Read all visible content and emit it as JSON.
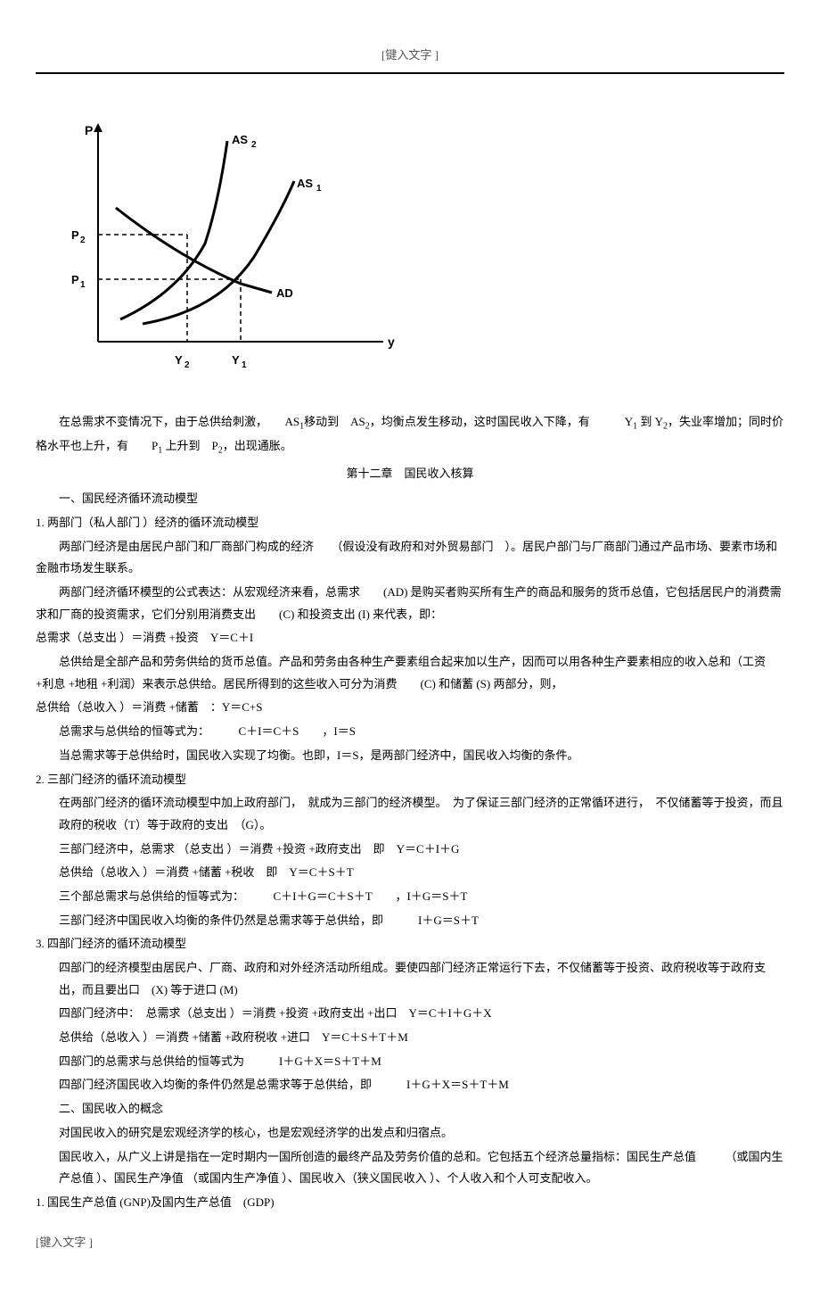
{
  "header": {
    "placeholder": "[键入文字 ]"
  },
  "footer": {
    "placeholder": "[键入文字 ]"
  },
  "chart_data": {
    "type": "line",
    "title": "",
    "xlabel": "y",
    "ylabel": "P",
    "curves": [
      {
        "name": "AS₂",
        "type": "upward"
      },
      {
        "name": "AS₁",
        "type": "upward"
      },
      {
        "name": "AD",
        "type": "downward"
      }
    ],
    "intersections": [
      {
        "label_x": "Y₂",
        "label_y": "P₂"
      },
      {
        "label_x": "Y₁",
        "label_y": "P₁"
      }
    ],
    "axis_labels": {
      "y_markers": [
        "P₂",
        "P₁"
      ],
      "x_markers": [
        "Y₂",
        "Y₁"
      ]
    }
  },
  "para1": {
    "part1": "在总需求不变情况下，由于总供给刺激，　　AS",
    "sub1": "1",
    "part2": "移动到　AS",
    "sub2": "2",
    "part3": "，均衡点发生移动，这时国民收入下降，有　　　Y",
    "sub3": "1",
    "part4": " 到 Y",
    "sub4": "2",
    "part5": "，失业率增加；同时价格水平也上升，有　　P",
    "sub5": "1",
    "part6": " 上升到　P",
    "sub6": "2",
    "part7": "，出现通胀。"
  },
  "chapter_title": "第十二章　国民收入核算",
  "section1_title": "一、国民经济循环流动模型",
  "item1_title": "1. 两部门（私人部门 ）经济的循环流动模型",
  "item1_p1": "两部门经济是由居民户部门和厂商部门构成的经济　　（假设没有政府和对外贸易部门　）。居民户部门与厂商部门通过产品市场、要素市场和金融市场发生联系。",
  "item1_p2": "两部门经济循环模型的公式表达：从宏观经济来看，总需求　　(AD) 是购买者购买所有生产的商品和服务的货币总值，它包括居民户的消费需求和厂商的投资需求，它们分别用消费支出　　(C) 和投资支出 (I) 来代表，即：",
  "item1_f1": "总需求（总支出 ）＝消费 +投资　Y＝C＋I",
  "item1_p3": "总供给是全部产品和劳务供给的货币总值。产品和劳务由各种生产要素组合起来加以生产，因而可以用各种生产要素相应的收入总和（工资 +利息 +地租 +利润）来表示总供给。居民所得到的这些收入可分为消费　　(C) 和储蓄 (S) 两部分，则，",
  "item1_f2": "总供给（总收入 ）＝消费 +储蓄　：Y＝C+S",
  "item1_p4": "总需求与总供给的恒等式为：　　　C＋I＝C＋S　　，I＝S",
  "item1_p5": "当总需求等于总供给时，国民收入实现了均衡。也即，I＝S，是两部门经济中，国民收入均衡的条件。",
  "item2_title": "2. 三部门经济的循环流动模型",
  "item2_p1": "在两部门经济的循环流动模型中加上政府部门，　就成为三部门的经济模型。　为了保证三部门经济的正常循环进行，　不仅储蓄等于投资，而且政府的税收（T）等于政府的支出　（G）。",
  "item2_p2": "三部门经济中，总需求 （总支出 ）＝消费 +投资 +政府支出　即　Y＝C＋I＋G",
  "item2_p3": "总供给（总收入 ）＝消费 +储蓄 +税收　即　Y＝C＋S＋T",
  "item2_p4": "三个部总需求与总供给的恒等式为：　　　C＋I＋G＝C＋S＋T　　，I＋G＝S＋T",
  "item2_p5": "三部门经济中国民收入均衡的条件仍然是总需求等于总供给，即　　　I＋G＝S＋T",
  "item3_title": "3. 四部门经济的循环流动模型",
  "item3_p1": "四部门的经济模型由居民户、厂商、政府和对外经济活动所组成。要使四部门经济正常运行下去，不仅储蓄等于投资、政府税收等于政府支出，而且要出口　(X) 等于进口 (M)",
  "item3_p2": "四部门经济中：　总需求（总支出 ）＝消费 +投资 +政府支出 +出口　Y＝C＋I＋G＋X",
  "item3_p3": "总供给（总收入 ）＝消费 +储蓄 +政府税收 +进口　Y＝C＋S＋T＋M",
  "item3_p4": "四部门的总需求与总供给的恒等式为　　　I＋G＋X＝S＋T＋M",
  "item3_p5": "四部门经济国民收入均衡的条件仍然是总需求等于总供给，即　　　I＋G＋X＝S＋T＋M",
  "section2_title": "二、国民收入的概念",
  "section2_p1": "对国民收入的研究是宏观经济学的核心，也是宏观经济学的出发点和归宿点。",
  "section2_p2": "国民收入，从广义上讲是指在一定时期内一国所创造的最终产品及劳务价值的总和。它包括五个经济总量指标：国民生产总值　　　（或国内生产总值 ）、国民生产净值 （或国内生产净值 ）、国民收入（狭义国民收入 ）、个人收入和个人可支配收入。",
  "section2_item1": "1. 国民生产总值 (GNP)及国内生产总值　(GDP)"
}
